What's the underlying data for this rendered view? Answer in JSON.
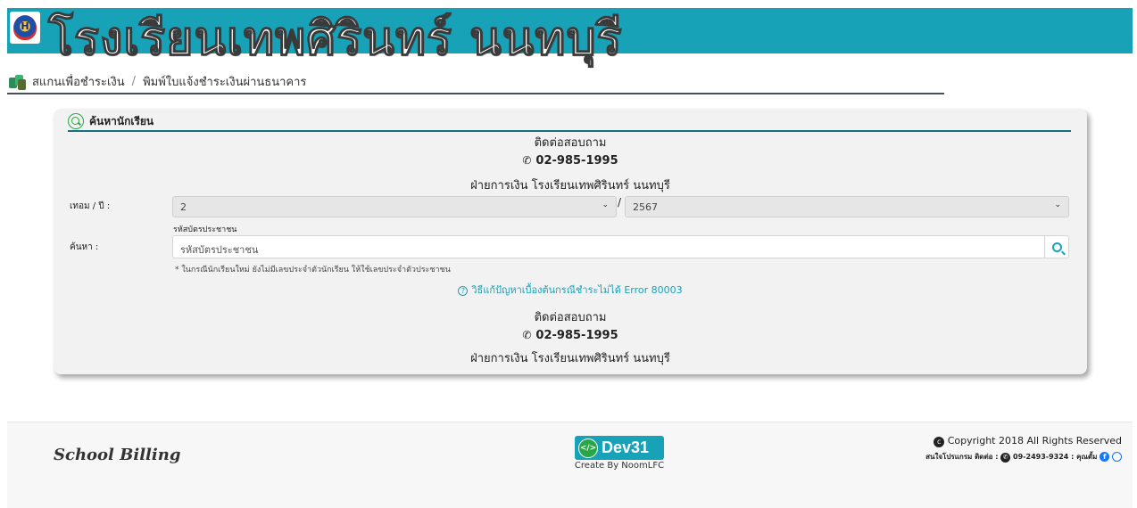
{
  "header": {
    "school_name": "โรงเรียนเทพศิรินทร์ นนทบุรี"
  },
  "breadcrumb": {
    "link": "สแกนเพื่อชำระเงิน",
    "separator": "/",
    "current": "พิมพ์ใบแจ้งชำระเงินผ่านธนาคาร"
  },
  "card": {
    "title": "ค้นหานักเรียน",
    "contact": {
      "title": "ติดต่อสอบถาม",
      "phone": "02-985-1995",
      "department": "ฝ่ายการเงิน โรงเรียนเทพศิรินทร์ นนทบุรี"
    },
    "term_label": "เทอม / ปี :",
    "term_value": "2",
    "year_separator": "/",
    "year_value": "2567",
    "id_hint": "รหัสบัตรประชาชน",
    "search_label": "ค้นหา :",
    "search_placeholder": "รหัสบัตรประชาชน",
    "note": "* ในกรณีนักเรียนใหม่ ยังไม่มีเลขประจำตัวนักเรียน ให้ใช้เลขประจำตัวประชาชน",
    "help_link": "วิธีแก้ปัญหาเบื้องต้นกรณีชำระไม่ได้ Error 80003"
  },
  "footer": {
    "brand": "School Billing",
    "dev_logo_text": "Dev31",
    "dev_credit": "Create By NoomLFC",
    "copyright": "Copyright 2018 All Rights Reserved",
    "contact_prefix": "สนใจโปรแกรม ติดต่อ :",
    "contact_phone": "09-2493-9324",
    "contact_name": "คุณตั้ม"
  },
  "colors": {
    "header_bg": "#17a2b8",
    "card_bg": "#f2f2f2",
    "link": "#17a2b8"
  }
}
